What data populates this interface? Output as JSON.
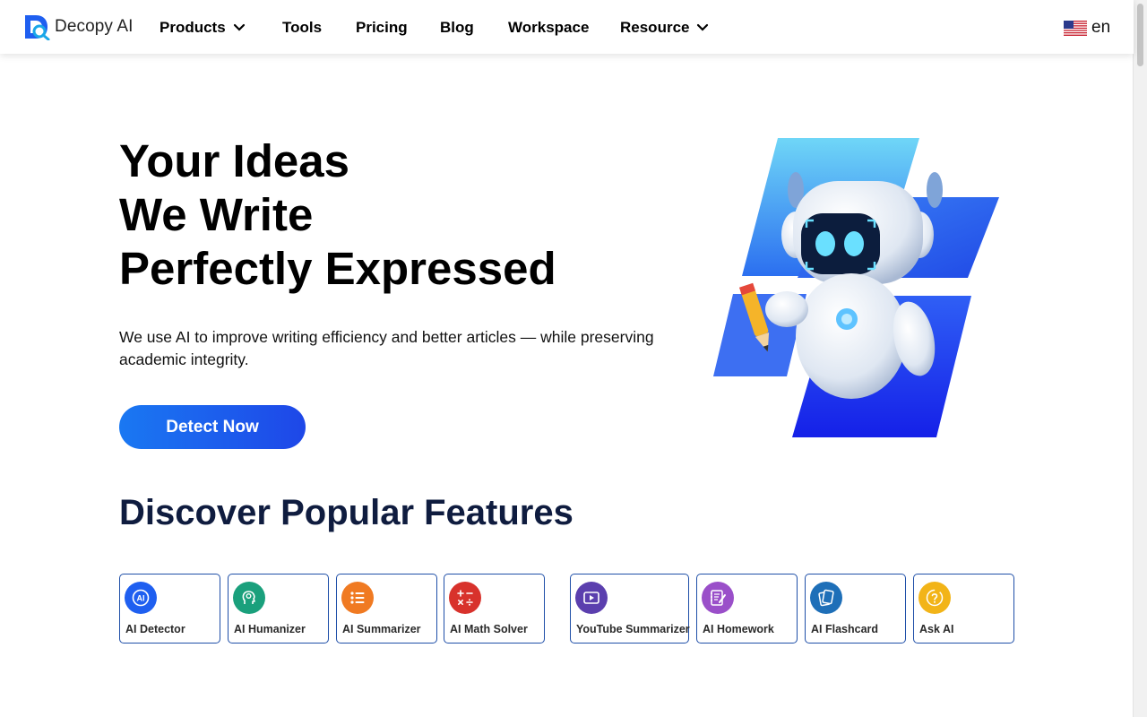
{
  "header": {
    "logo_text": "Decopy AI",
    "nav": {
      "products": "Products",
      "tools": "Tools",
      "pricing": "Pricing",
      "blog": "Blog",
      "workspace": "Workspace",
      "resource": "Resource"
    },
    "language": "en"
  },
  "hero": {
    "title_line1": "Your Ideas",
    "title_line2": "We Write",
    "title_line3": "Perfectly Expressed",
    "subtitle": "We use AI to improve writing efficiency and better articles — while preserving academic integrity.",
    "cta_label": "Detect Now"
  },
  "features": {
    "title": "Discover Popular Features",
    "cards": [
      {
        "label": "AI Detector",
        "icon": "ai-detector-icon",
        "color": "#1f5ff0"
      },
      {
        "label": "AI Humanizer",
        "icon": "humanizer-head-icon",
        "color": "#1aa07c"
      },
      {
        "label": "AI Summarizer",
        "icon": "list-icon",
        "color": "#f07a22"
      },
      {
        "label": "AI Math Solver",
        "icon": "math-operators-icon",
        "color": "#d8322c"
      },
      {
        "label": "YouTube Summarizer",
        "icon": "video-play-icon",
        "color": "#5b3fae"
      },
      {
        "label": "AI Homework",
        "icon": "notebook-pen-icon",
        "color": "#9a4fc9"
      },
      {
        "label": "AI Flashcard",
        "icon": "flashcard-icon",
        "color": "#1e6fb8"
      },
      {
        "label": "Ask AI",
        "icon": "question-icon",
        "color": "#f2b418"
      }
    ]
  },
  "colors": {
    "primary": "#1a78f2",
    "heading_dark": "#0f1c3f",
    "card_border": "#1f4fa8"
  }
}
